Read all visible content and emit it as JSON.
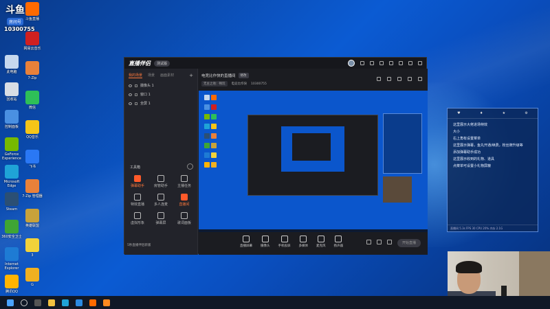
{
  "desktop_icons": [
    {
      "label": "此电脑",
      "color": "#c6d8ee"
    },
    {
      "label": "回收站",
      "color": "#d8dde4"
    },
    {
      "label": "控制面板",
      "color": "#4a90e2"
    },
    {
      "label": "GeForce Experience",
      "color": "#76b900"
    },
    {
      "label": "Microsoft Edge",
      "color": "#1fa3d7"
    },
    {
      "label": "Steam",
      "color": "#2b4f74"
    },
    {
      "label": "360安全卫士",
      "color": "#3fa535"
    },
    {
      "label": "Internet Explorer",
      "color": "#1e7bd4"
    },
    {
      "label": "腾讯QQ",
      "color": "#ffb400"
    }
  ],
  "desktop_icons_col2": [
    {
      "label": "斗鱼直播",
      "color": "#ff6a00"
    },
    {
      "label": "网易云音乐",
      "color": "#d02020"
    },
    {
      "label": "7-Zip",
      "color": "#e8813a"
    },
    {
      "label": "微信",
      "color": "#2ebf58"
    },
    {
      "label": "QQ音乐",
      "color": "#f5c518"
    },
    {
      "label": "飞书",
      "color": "#2a78f5"
    },
    {
      "label": "7-Zip 管理器",
      "color": "#e8813a"
    },
    {
      "label": "英雄联盟",
      "color": "#c8a23a"
    },
    {
      "label": "3",
      "color": "#f2d23a"
    },
    {
      "label": "G",
      "color": "#f0b020"
    }
  ],
  "overlay": {
    "badge": "斗鱼",
    "room_label": "房间号",
    "room_id": "10300755"
  },
  "app": {
    "logo": "直播伴侣",
    "version": "测试版",
    "tabs": [
      "我的场景",
      "场景",
      "画面素材"
    ],
    "sources": [
      "摄像头 1",
      "窗口 1",
      "全屏 1"
    ],
    "tools_title": "工具箱",
    "tools": [
      {
        "label": "弹幕助手",
        "hot": true
      },
      {
        "label": "房管助手",
        "hot": false
      },
      {
        "label": "主播任务",
        "hot": false
      },
      {
        "label": "特效直播",
        "hot": false
      },
      {
        "label": "多人连麦",
        "hot": false
      },
      {
        "label": "直播间",
        "hot": true
      },
      {
        "label": "虚拟形象",
        "hot": false
      },
      {
        "label": "弹幕屏",
        "hot": false
      },
      {
        "label": "歌词面板",
        "hot": false
      }
    ],
    "notice": "5秒直播伴侣新版",
    "room_title": "电竞比作快的直播间",
    "modify": "修改",
    "room_info": [
      "无主之地：畅玩",
      "电竞比作快",
      "10300755"
    ],
    "bottom_items": [
      "直播屏幕",
      "摄像头",
      "手机投屏",
      "多媒体",
      "麦克风",
      "扬声器"
    ],
    "start_label": "开始直播"
  },
  "chat": {
    "messages": [
      "这里展示大佬进场特效",
      "大小",
      "右上角有设置菜单",
      "这里展示弹幕，鱼丸开通/续费，粉丝牌升级等",
      "添加弹幕助手成功",
      "这里展示收到的礼物、道具",
      "点菜单可设置小礼物屏蔽"
    ],
    "footer": "直播间 5.3s  FPS 30  CPU 20%  内存 2.1G"
  }
}
